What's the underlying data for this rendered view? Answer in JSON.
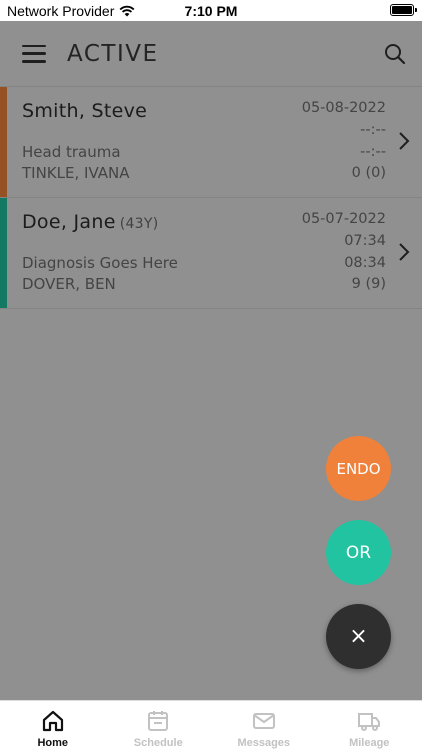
{
  "status_bar": {
    "carrier": "Network Provider",
    "time": "7:10 PM"
  },
  "header": {
    "title": "ACTIVE"
  },
  "cases": [
    {
      "name": "Smith, Steve",
      "age": "",
      "date": "05-08-2022",
      "time_in": "--:--",
      "diagnosis": "Head trauma",
      "time_out": "--:--",
      "surgeon": "TINKLE, IVANA",
      "count": "0 (0)",
      "accent_color": "#f0813b"
    },
    {
      "name": "Doe, Jane",
      "age": "(43Y)",
      "date": "05-07-2022",
      "time_in": "07:34",
      "diagnosis": "Diagnosis Goes Here",
      "time_out": "08:34",
      "surgeon": "DOVER, BEN",
      "count": "9 (9)",
      "accent_color": "#21c3a0"
    }
  ],
  "fab": {
    "endo_label": "ENDO",
    "or_label": "OR",
    "close_label": "×"
  },
  "tabs": [
    {
      "label": "Home",
      "icon": "home-icon",
      "active": true
    },
    {
      "label": "Schedule",
      "icon": "calendar-icon",
      "active": false
    },
    {
      "label": "Messages",
      "icon": "mail-icon",
      "active": false
    },
    {
      "label": "Mileage",
      "icon": "truck-icon",
      "active": false
    }
  ],
  "colors": {
    "endo": "#f0813b",
    "or": "#21c3a0",
    "close": "#2f2f2f"
  }
}
